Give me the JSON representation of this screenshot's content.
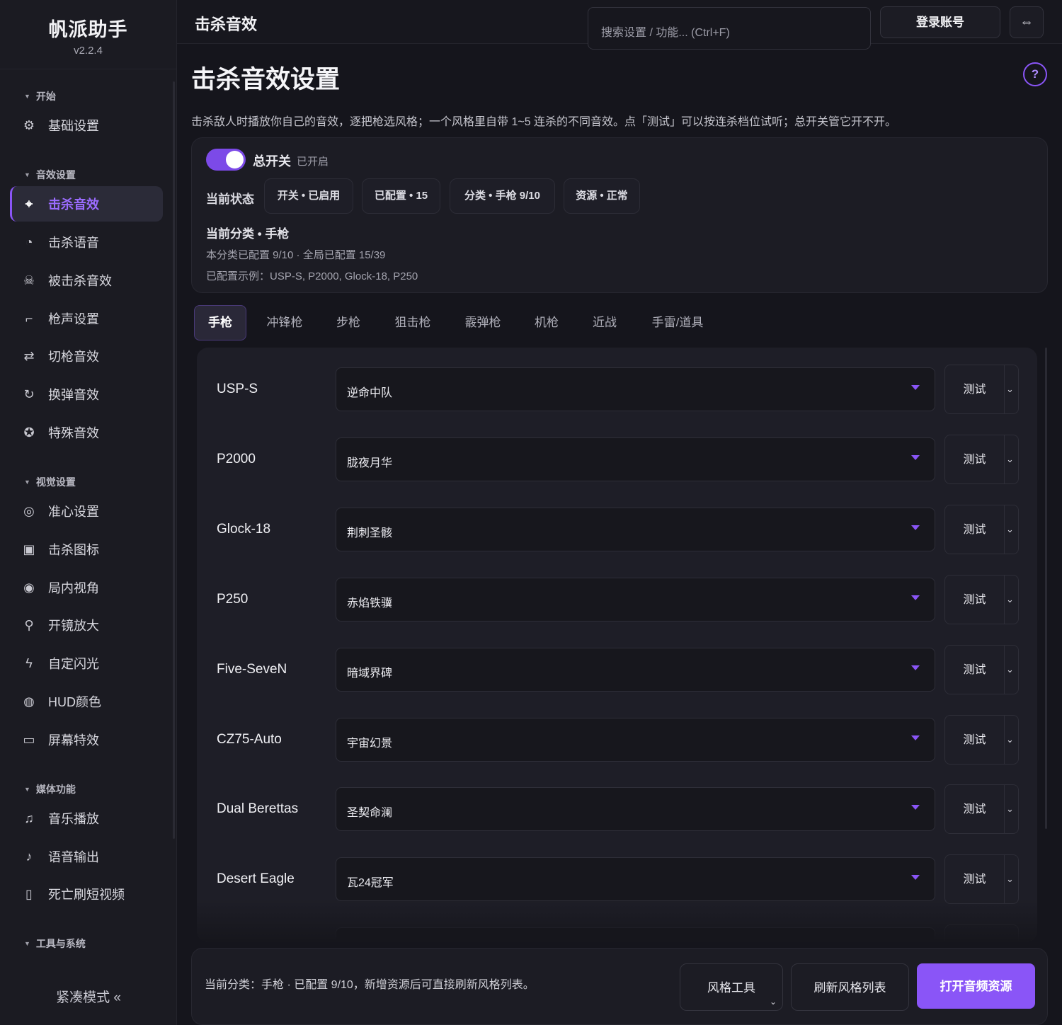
{
  "app": {
    "name": "帆派助手",
    "version": "v2.2.4"
  },
  "sidebar": {
    "groups": [
      {
        "title": "开始",
        "items": [
          {
            "label": "基础设置",
            "icon": "gear-icon"
          }
        ]
      },
      {
        "title": "音效设置",
        "items": [
          {
            "label": "击杀音效",
            "icon": "crosshair-icon",
            "active": true
          },
          {
            "label": "击杀语音",
            "icon": "voice-icon"
          },
          {
            "label": "被击杀音效",
            "icon": "skull-icon"
          },
          {
            "label": "枪声设置",
            "icon": "gun-icon"
          },
          {
            "label": "切枪音效",
            "icon": "swap-arrows-icon"
          },
          {
            "label": "换弹音效",
            "icon": "reload-icon"
          },
          {
            "label": "特殊音效",
            "icon": "special-icon"
          }
        ]
      },
      {
        "title": "视觉设置",
        "items": [
          {
            "label": "准心设置",
            "icon": "target-icon"
          },
          {
            "label": "击杀图标",
            "icon": "image-icon"
          },
          {
            "label": "局内视角",
            "icon": "eye-icon"
          },
          {
            "label": "开镜放大",
            "icon": "magnifier-icon"
          },
          {
            "label": "自定闪光",
            "icon": "lightning-icon"
          },
          {
            "label": "HUD颜色",
            "icon": "palette-icon"
          },
          {
            "label": "屏幕特效",
            "icon": "monitor-icon"
          }
        ]
      },
      {
        "title": "媒体功能",
        "items": [
          {
            "label": "音乐播放",
            "icon": "music-icon"
          },
          {
            "label": "语音输出",
            "icon": "microphone-icon"
          },
          {
            "label": "死亡刷短视频",
            "icon": "phone-icon"
          }
        ]
      },
      {
        "title": "工具与系统",
        "items": []
      }
    ],
    "compact_mode": "紧凑模式 «"
  },
  "topbar": {
    "title": "击杀音效",
    "search_placeholder": "搜索设置 / 功能... (Ctrl+F)",
    "login_label": "登录账号",
    "swap_icon": "⇔"
  },
  "page": {
    "title": "击杀音效设置",
    "help": "?",
    "description": "击杀敌人时播放你自己的音效，逐把枪选风格；一个风格里自带 1~5 连杀的不同音效。点「测试」可以按连杀档位试听；总开关管它开不开。"
  },
  "status": {
    "toggle_label": "总开关",
    "toggle_state": "已开启",
    "toggle_on": true,
    "current_label": "当前状态",
    "pills": [
      "开关 • 已启用",
      "已配置 • 15",
      "分类 • 手枪 9/10",
      "资源 • 正常"
    ],
    "category_title": "当前分类 • 手枪",
    "category_line1": "本分类已配置 9/10 · 全局已配置 15/39",
    "category_line2": "已配置示例：USP-S, P2000, Glock-18, P250"
  },
  "tabs": [
    "手枪",
    "冲锋枪",
    "步枪",
    "狙击枪",
    "霰弹枪",
    "机枪",
    "近战",
    "手雷/道具"
  ],
  "active_tab": "手枪",
  "weapons": [
    {
      "name": "USP-S",
      "style": "逆命中队"
    },
    {
      "name": "P2000",
      "style": "胧夜月华"
    },
    {
      "name": "Glock-18",
      "style": "荆刺圣骸"
    },
    {
      "name": "P250",
      "style": "赤焰铁骥"
    },
    {
      "name": "Five-SeveN",
      "style": "暗域界碑"
    },
    {
      "name": "CZ75-Auto",
      "style": "宇宙幻景"
    },
    {
      "name": "Dual Berettas",
      "style": "圣契命澜"
    },
    {
      "name": "Desert Eagle",
      "style": "瓦24冠军"
    }
  ],
  "test_label": "测试",
  "footer": {
    "text": "当前分类：手枪 · 已配置 9/10，新增资源后可直接刷新风格列表。",
    "style_tools": "风格工具",
    "refresh": "刷新风格列表",
    "open_resources": "打开音频资源"
  },
  "colors": {
    "accent": "#8a55f7",
    "background": "#15151c",
    "sidebar": "#1b1b22"
  }
}
